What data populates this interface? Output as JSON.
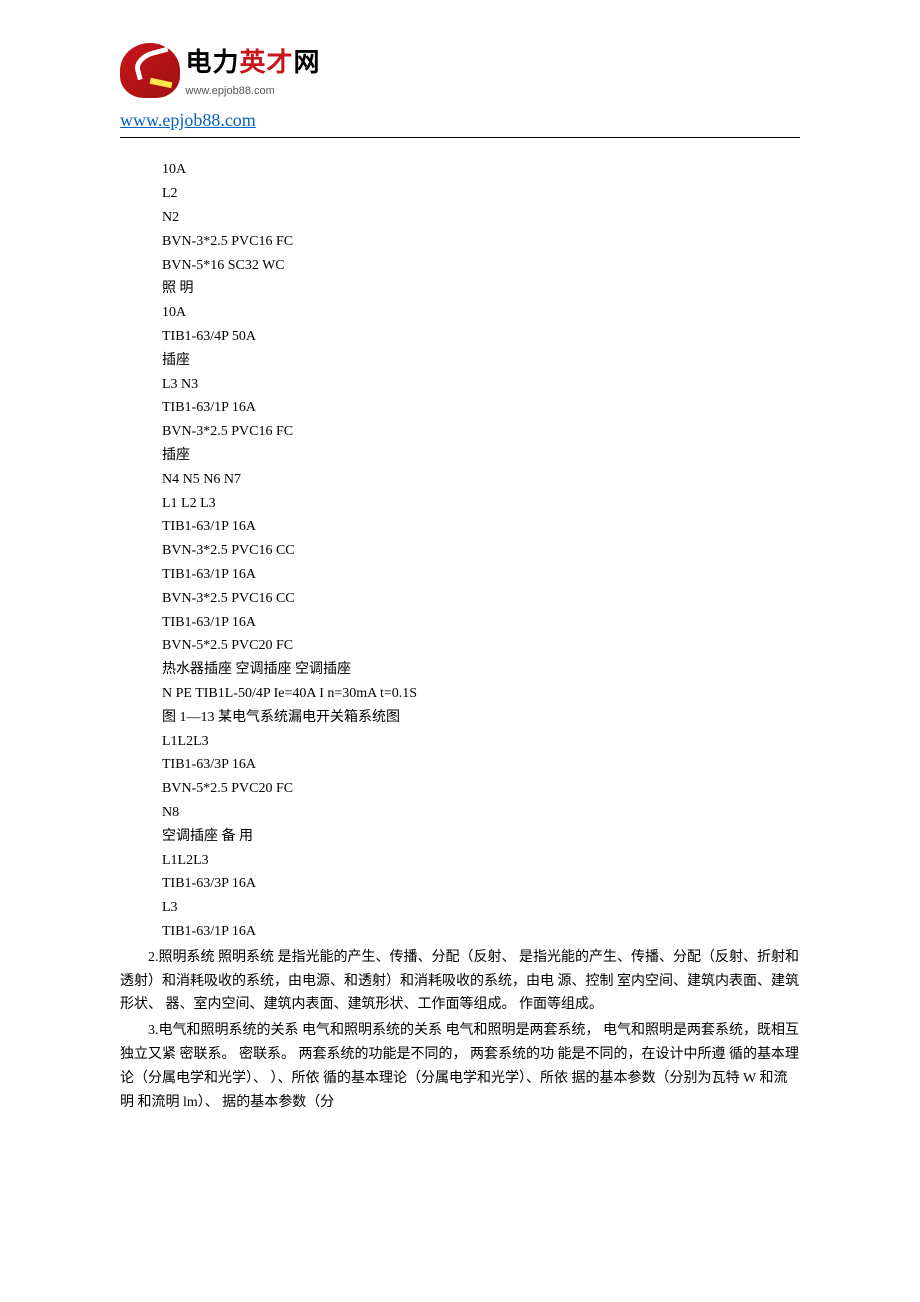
{
  "header": {
    "logo_cn_part1": "电力",
    "logo_cn_highlight": "英才",
    "logo_cn_part2": "网",
    "logo_url_small": "www.epjob88.com",
    "site_url": "www.epjob88.com"
  },
  "lines": [
    "10A",
    "L2",
    "N2",
    "BVN-3*2.5 PVC16 FC",
    "BVN-5*16 SC32 WC",
    "照 明",
    "10A",
    "TIB1-63/4P 50A",
    "插座",
    "L3 N3",
    "TIB1-63/1P 16A",
    "BVN-3*2.5 PVC16 FC",
    "插座",
    "N4 N5 N6 N7",
    "L1 L2 L3",
    "TIB1-63/1P 16A",
    "BVN-3*2.5 PVC16 CC",
    "TIB1-63/1P 16A",
    "BVN-3*2.5 PVC16 CC",
    "TIB1-63/1P 16A",
    "BVN-5*2.5 PVC20 FC",
    "热水器插座 空调插座 空调插座",
    "N PE TIB1L-50/4P Ie=40A I n=30mA t=0.1S",
    "图 1—13 某电气系统漏电开关箱系统图",
    "L1L2L3",
    "TIB1-63/3P 16A",
    "BVN-5*2.5 PVC20 FC",
    "N8",
    "空调插座 备 用",
    "L1L2L3",
    "TIB1-63/3P 16A",
    "L3",
    "TIB1-63/1P 16A"
  ],
  "paragraphs": [
    "2.照明系统 照明系统 是指光能的产生、传播、分配（反射、 是指光能的产生、传播、分配（反射、折射和透射）和消耗吸收的系统，由电源、和透射）和消耗吸收的系统，由电 源、控制 室内空间、建筑内表面、建筑形状、 器、室内空间、建筑内表面、建筑形状、工作面等组成。 作面等组成。",
    "3.电气和照明系统的关系 电气和照明系统的关系 电气和照明是两套系统， 电气和照明是两套系统，既相互独立又紧 密联系。 密联系。 两套系统的功能是不同的， 两套系统的功 能是不同的，在设计中所遵 循的基本理论（分属电学和光学）、 ）、所依 循的基本理论（分属电学和光学）、所依 据的基本参数（分别为瓦特 W 和流明 和流明 lm）、 据的基本参数（分"
  ]
}
